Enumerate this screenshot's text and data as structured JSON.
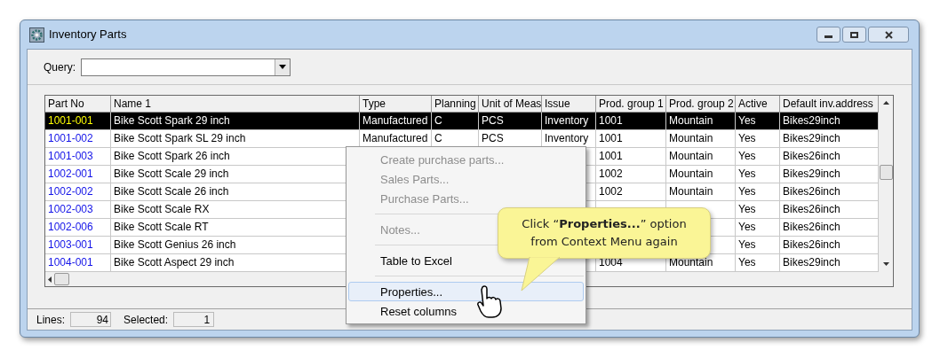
{
  "window": {
    "title": "Inventory Parts"
  },
  "query": {
    "label": "Query:"
  },
  "table": {
    "columns": [
      "Part No",
      "Name 1",
      "Type",
      "Planning",
      "Unit of Meas",
      "Issue",
      "Prod. group 1",
      "Prod. group 2",
      "Active",
      "Default inv.address"
    ],
    "rows": [
      {
        "selected": true,
        "cells": [
          "1001-001",
          "Bike Scott Spark 29 inch",
          "Manufactured",
          "C",
          "PCS",
          "Inventory",
          "1001",
          "Mountain",
          "Yes",
          "Bikes29inch"
        ]
      },
      {
        "selected": false,
        "cells": [
          "1001-002",
          "Bike Scott Spark SL 29 inch",
          "Manufactured",
          "C",
          "PCS",
          "Inventory",
          "1001",
          "Mountain",
          "Yes",
          "Bikes29inch"
        ]
      },
      {
        "selected": false,
        "cells": [
          "1001-003",
          "Bike Scott Spark 26 inch",
          null,
          null,
          null,
          null,
          "1001",
          "Mountain",
          "Yes",
          "Bikes26inch"
        ]
      },
      {
        "selected": false,
        "cells": [
          "1002-001",
          "Bike Scott Scale 29 inch",
          null,
          null,
          null,
          null,
          "1002",
          "Mountain",
          "Yes",
          "Bikes29inch"
        ]
      },
      {
        "selected": false,
        "cells": [
          "1002-002",
          "Bike Scott Scale 26 inch",
          null,
          null,
          null,
          null,
          "1002",
          "Mountain",
          "Yes",
          "Bikes26inch"
        ]
      },
      {
        "selected": false,
        "cells": [
          "1002-003",
          "Bike Scott Scale RX",
          null,
          null,
          null,
          null,
          null,
          null,
          "Yes",
          "Bikes26inch"
        ]
      },
      {
        "selected": false,
        "cells": [
          "1002-006",
          "Bike Scott Scale RT",
          null,
          null,
          null,
          null,
          null,
          null,
          "Yes",
          "Bikes26inch"
        ]
      },
      {
        "selected": false,
        "cells": [
          "1003-001",
          "Bike Scott Genius 26 inch",
          null,
          null,
          null,
          null,
          null,
          null,
          "Yes",
          "Bikes26inch"
        ]
      },
      {
        "selected": false,
        "cells": [
          "1004-001",
          "Bike Scott Aspect 29 inch",
          null,
          null,
          null,
          null,
          "1004",
          "Mountain",
          "Yes",
          "Bikes29inch"
        ]
      }
    ]
  },
  "status_bar": {
    "lines_label": "Lines:",
    "lines": "94",
    "selected_label": "Selected:",
    "selected": "1"
  },
  "context_menu": {
    "items": [
      {
        "kind": "item",
        "label": "Create purchase parts...",
        "disabled": true,
        "selected": false
      },
      {
        "kind": "item",
        "label": "Sales Parts...",
        "disabled": true,
        "selected": false
      },
      {
        "kind": "item",
        "label": "Purchase Parts...",
        "disabled": true,
        "selected": false
      },
      {
        "kind": "separator"
      },
      {
        "kind": "item",
        "label": "Notes...",
        "disabled": true,
        "selected": false
      },
      {
        "kind": "separator"
      },
      {
        "kind": "item",
        "label": "Table to Excel",
        "disabled": false,
        "selected": false
      },
      {
        "kind": "separator"
      },
      {
        "kind": "item",
        "label": "Properties...",
        "disabled": false,
        "selected": true
      },
      {
        "kind": "item",
        "label": "Reset columns",
        "disabled": false,
        "selected": false
      }
    ]
  },
  "callout": {
    "text": "Click “**Properties...**” option from Context Menu again"
  }
}
